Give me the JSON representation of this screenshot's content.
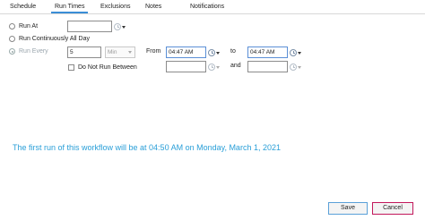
{
  "tabs": {
    "schedule": "Schedule",
    "run_times": "Run Times",
    "exclusions": "Exclusions",
    "notes": "Notes",
    "notifications": "Notifications",
    "active": "Run Times"
  },
  "options": {
    "run_at": {
      "label": "Run At",
      "value": ""
    },
    "run_continuously": {
      "label": "Run Continuously All Day"
    },
    "run_every": {
      "label": "Run Every",
      "interval": "5",
      "unit": "Min",
      "from_label": "From",
      "from_time": "04:47 AM",
      "to_label": "to",
      "to_time": "04:47 AM",
      "selected": true
    },
    "do_not_run_between": {
      "label": "Do Not Run Between",
      "and_label": "and",
      "start_time": "",
      "end_time": "",
      "checked": false
    }
  },
  "message": "The first run of this workflow will be at 04:50 AM on Monday, March 1, 2021",
  "buttons": {
    "save": "Save",
    "cancel": "Cancel"
  },
  "colors": {
    "accent": "#3a8dd6",
    "message": "#2a9fd8",
    "cancel_border": "#c2185b"
  },
  "icons": [
    "clock-icon",
    "chevron-down-icon"
  ]
}
